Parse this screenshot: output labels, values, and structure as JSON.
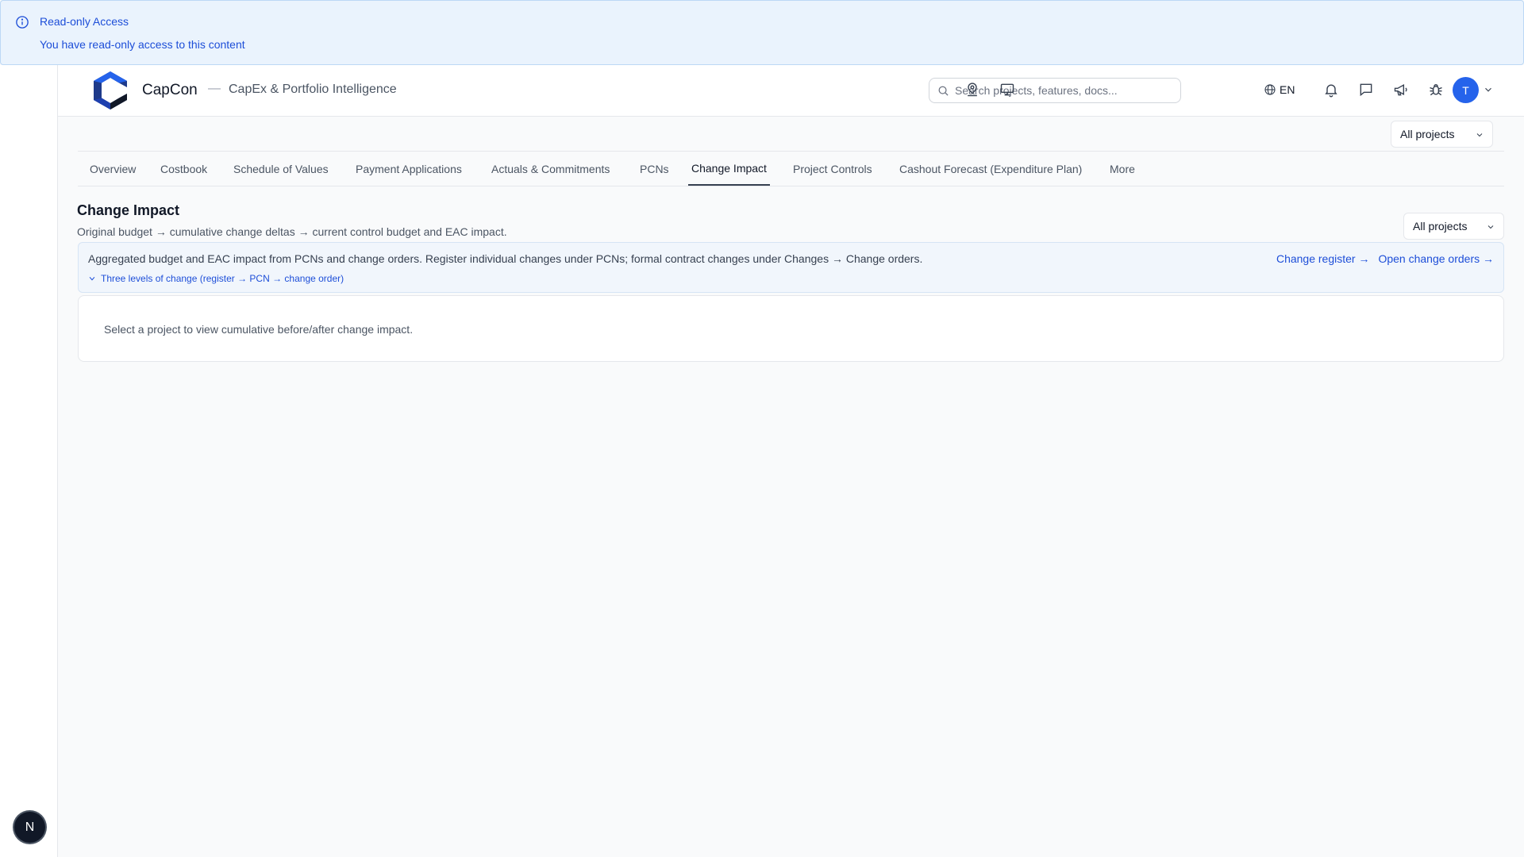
{
  "banner": {
    "title": "Read-only Access",
    "message": "You have read-only access to this content"
  },
  "rail": {
    "badge_letter": "N"
  },
  "header": {
    "brand": "CapCon",
    "separator": "—",
    "subtitle": "CapEx & Portfolio Intelligence",
    "search_placeholder": "Search projects, features, docs...",
    "language": "EN",
    "avatar_letter": "T",
    "icons": [
      "user-pin-icon",
      "monitor-icon",
      "globe-icon",
      "bell-icon",
      "chat-icon",
      "megaphone-icon",
      "bug-icon"
    ]
  },
  "top_filter": {
    "value": "All projects"
  },
  "tabs": [
    {
      "label": "Overview",
      "active": false
    },
    {
      "label": "Costbook",
      "active": false
    },
    {
      "label": "Schedule of Values",
      "active": false
    },
    {
      "label": "Payment Applications",
      "active": false
    },
    {
      "label": "Actuals & Commitments",
      "active": false
    },
    {
      "label": "PCNs",
      "active": false
    },
    {
      "label": "Change Impact",
      "active": true
    },
    {
      "label": "Project Controls",
      "active": false
    },
    {
      "label": "Cashout Forecast (Expenditure Plan)",
      "active": false
    },
    {
      "label": "More",
      "active": false
    }
  ],
  "page": {
    "title": "Change Impact",
    "subtitle": "Original budget → cumulative change deltas → current control budget and EAC impact.",
    "project_filter": "All projects"
  },
  "info": {
    "text": "Aggregated budget and EAC impact from PCNs and change orders. Register individual changes under PCNs; formal contract changes under Changes → Change orders.",
    "levels_toggle": "Three levels of change (register → PCN → change order)",
    "link_register": "Change register →",
    "link_change_orders": "Open change orders →"
  },
  "empty_state": {
    "text": "Select a project to view cumulative before/after change impact."
  },
  "colors": {
    "accent": "#2563eb",
    "link": "#1d4ed8",
    "banner_bg": "#eaf3fd",
    "page_bg": "#f9fafb"
  }
}
